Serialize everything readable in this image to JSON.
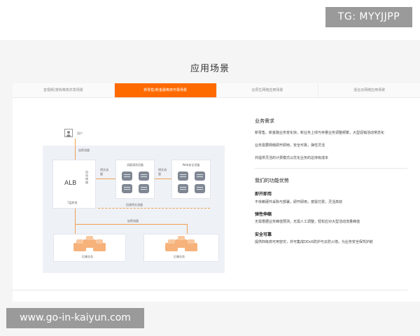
{
  "watermarks": {
    "top_right": "TG: MYYJJPP",
    "bottom_left": "www.go-in-kaiyun.com"
  },
  "section": {
    "title": "应用场景"
  },
  "tabs": [
    {
      "label": "音视频/游戏等高并发场景",
      "active": false
    },
    {
      "label": "新零售/新金融等高可靠场景",
      "active": true
    },
    {
      "label": "云原生网络应用场景",
      "active": false
    },
    {
      "label": "混合云网络应用场景",
      "active": false
    }
  ],
  "diagram": {
    "user": "用户",
    "public_traffic": "加密流量",
    "alb": "ALB",
    "alb_side": "自动伸缩",
    "alb_sub": "7层转发",
    "plain_to_pool": "明文流量",
    "pool1_title": "流量清洗设备",
    "plain_between": "明文流量",
    "pool2_title": "Web安全设备",
    "return_traffic": "回源明文流量",
    "encrypt_traffic": "加密流量",
    "backend_left": "后端业务",
    "backend_right": "后端业务"
  },
  "requirements": {
    "heading": "业务需求",
    "lines": [
      "新零售、新金融业务变化快，新业务上线与存量业务调整频繁，大型促销活动常态化",
      "业务需要网络即开即用，安全可靠，弹性灵活",
      "并提供灵活的计费模式以优化业务的总持有成本"
    ]
  },
  "advantages": {
    "heading": "我们的功能优势",
    "items": [
      {
        "title": "即开即用",
        "desc": "不依赖硬件采购与部署，即开即用，按需付费，灵活高效"
      },
      {
        "title": "弹性伸缩",
        "desc": "无需根据业务峰值预测，无需人工调整，轻松应对大型活动流量峰值"
      },
      {
        "title": "安全可靠",
        "desc": "提供四级高可用容灾，并可集成DDoS防护与云防火墙，为业务安全保驾护航"
      }
    ]
  },
  "colors": {
    "accent": "#ff6a00",
    "section_bg": "#f5f5f5",
    "diagram_bg": "#eef1f6"
  }
}
